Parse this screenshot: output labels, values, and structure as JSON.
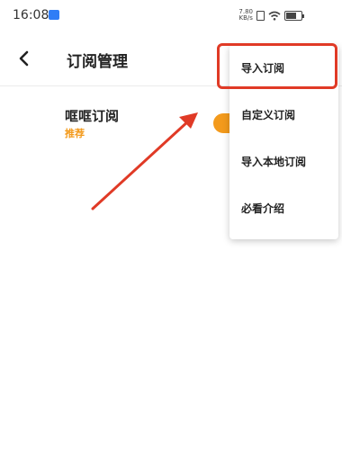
{
  "status_bar": {
    "time": "16:08",
    "speed_value": "7.80",
    "speed_unit": "KB/s",
    "app_badge_icon": "app-notification-icon",
    "sim_icon": "sim-card-icon",
    "wifi_icon": "wifi-icon",
    "battery_icon": "battery-icon",
    "battery_level": "64"
  },
  "header": {
    "back_icon": "back-arrow-icon",
    "title": "订阅管理"
  },
  "subscriptions": [
    {
      "name": "哐哐订阅",
      "tag": "推荐",
      "enabled": true
    }
  ],
  "menu": {
    "items": [
      {
        "label": "导入订阅",
        "highlighted": true
      },
      {
        "label": "自定义订阅"
      },
      {
        "label": "导入本地订阅"
      },
      {
        "label": "必看介绍"
      }
    ]
  },
  "colors": {
    "accent": "#f39a1c",
    "annotation": "#e03a26"
  }
}
